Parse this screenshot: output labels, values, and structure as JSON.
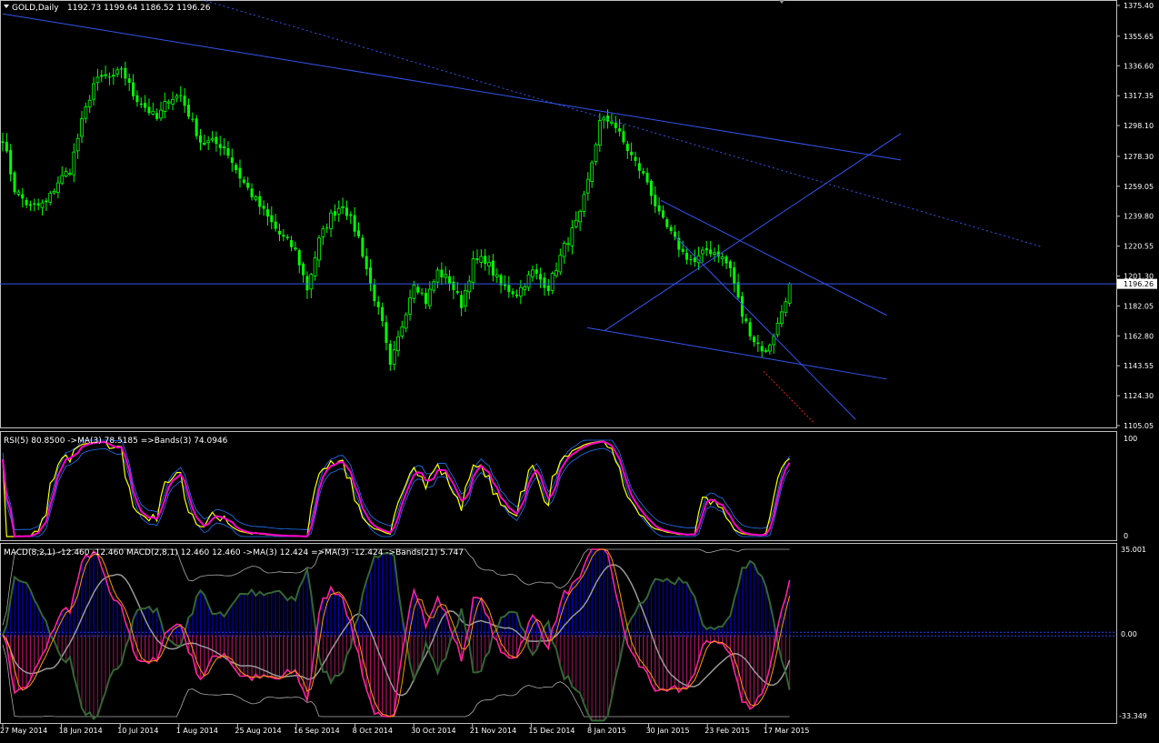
{
  "header": {
    "symbol": "GOLD,Daily",
    "ohlc": "1192.73 1199.64 1186.52 1196.26"
  },
  "colors": {
    "background": "#000000",
    "frame": "#c0c0c0",
    "candle_bull": "#00ff00",
    "trendline": "#3355ee",
    "rsi_line": "#ffff00",
    "rsi_ma": "#ff00cc",
    "rsi_bands": "#2277ff",
    "macd_hist_pos": "#0000dd",
    "macd_hist_neg": "#aa1166",
    "macd_fast": "#ff2299",
    "macd_slow": "#336633",
    "macd_ma": "#ff9900",
    "macd_ma_mid": "#999999",
    "macd_bands": "#aaaaaa",
    "price_tag": "#ffffff"
  },
  "price_axis": {
    "ticks": [
      "1375.40",
      "1355.65",
      "1336.60",
      "1317.35",
      "1298.10",
      "1278.30",
      "1259.05",
      "1239.80",
      "1220.55",
      "1201.30",
      "1182.05",
      "1162.80",
      "1143.55",
      "1124.30",
      "1105.05"
    ],
    "current": "1196.26"
  },
  "rsi": {
    "label": "RSI(5) 80.8500  ->MA(3) 78.5185  =>Bands(3) 74.0946",
    "top": "100",
    "bottom": "0"
  },
  "macd": {
    "label": "MACD(8,2,1) -12.460 -12.460  MACD(2,8,1) 12.460 12.460  ->MA(3) 12.424  =>MA(3) -12.424  ->Bands(21) 5.747",
    "top": "35.001",
    "zero": "0.00",
    "bottom": "-33.349"
  },
  "time_axis": {
    "labels": [
      "27 May 2014",
      "18 Jun 2014",
      "10 Jul 2014",
      "1 Aug 2014",
      "25 Aug 2014",
      "16 Sep 2014",
      "8 Oct 2014",
      "30 Oct 2014",
      "21 Nov 2014",
      "15 Dec 2014",
      "8 Jan 2015",
      "30 Jan 2015",
      "23 Feb 2015",
      "17 Mar 2015"
    ]
  },
  "chart_data": {
    "type": "candlestick",
    "instrument": "GOLD",
    "timeframe": "Daily",
    "price_range": [
      1105.05,
      1375.4
    ],
    "anchors": [
      [
        0,
        1290
      ],
      [
        3,
        1257
      ],
      [
        7,
        1245
      ],
      [
        11,
        1248
      ],
      [
        14,
        1262
      ],
      [
        17,
        1270
      ],
      [
        20,
        1300
      ],
      [
        23,
        1325
      ],
      [
        26,
        1330
      ],
      [
        28,
        1328
      ],
      [
        30,
        1335
      ],
      [
        33,
        1318
      ],
      [
        36,
        1310
      ],
      [
        39,
        1302
      ],
      [
        42,
        1316
      ],
      [
        45,
        1317
      ],
      [
        48,
        1300
      ],
      [
        50,
        1288
      ],
      [
        53,
        1287
      ],
      [
        56,
        1285
      ],
      [
        60,
        1265
      ],
      [
        65,
        1246
      ],
      [
        70,
        1228
      ],
      [
        74,
        1218
      ],
      [
        77,
        1193
      ],
      [
        80,
        1224
      ],
      [
        83,
        1240
      ],
      [
        86,
        1248
      ],
      [
        90,
        1226
      ],
      [
        93,
        1196
      ],
      [
        96,
        1170
      ],
      [
        98,
        1142
      ],
      [
        101,
        1170
      ],
      [
        104,
        1198
      ],
      [
        107,
        1185
      ],
      [
        110,
        1204
      ],
      [
        113,
        1198
      ],
      [
        116,
        1183
      ],
      [
        119,
        1210
      ],
      [
        122,
        1212
      ],
      [
        126,
        1195
      ],
      [
        130,
        1190
      ],
      [
        134,
        1204
      ],
      [
        138,
        1194
      ],
      [
        142,
        1220
      ],
      [
        146,
        1240
      ],
      [
        148,
        1262
      ],
      [
        151,
        1300
      ],
      [
        154,
        1302
      ],
      [
        157,
        1287
      ],
      [
        160,
        1274
      ],
      [
        163,
        1262
      ],
      [
        166,
        1240
      ],
      [
        169,
        1228
      ],
      [
        172,
        1216
      ],
      [
        175,
        1210
      ],
      [
        178,
        1218
      ],
      [
        181,
        1216
      ],
      [
        184,
        1206
      ],
      [
        187,
        1176
      ],
      [
        190,
        1160
      ],
      [
        193,
        1152
      ],
      [
        196,
        1170
      ],
      [
        199,
        1196
      ]
    ],
    "trendlines": [
      {
        "from": [
          "2014-05-27",
          1370
        ],
        "to": [
          "2015-04-10",
          1276
        ],
        "style": "solid"
      },
      {
        "from": [
          "2014-06-20",
          1404
        ],
        "to": [
          "2015-05-30",
          1220
        ],
        "style": "dotted"
      },
      {
        "from": [
          "2014-12-20",
          1168
        ],
        "to": [
          "2015-04-05",
          1135
        ],
        "style": "solid"
      },
      {
        "from": [
          "2014-12-26",
          1166
        ],
        "to": [
          "2015-04-10",
          1293
        ],
        "style": "solid"
      },
      {
        "from": [
          "2015-01-15",
          1250
        ],
        "to": [
          "2015-04-05",
          1176
        ],
        "style": "solid"
      },
      {
        "from": [
          "2015-01-20",
          1227
        ],
        "to": [
          "2015-03-25",
          1109
        ],
        "style": "solid"
      }
    ]
  }
}
